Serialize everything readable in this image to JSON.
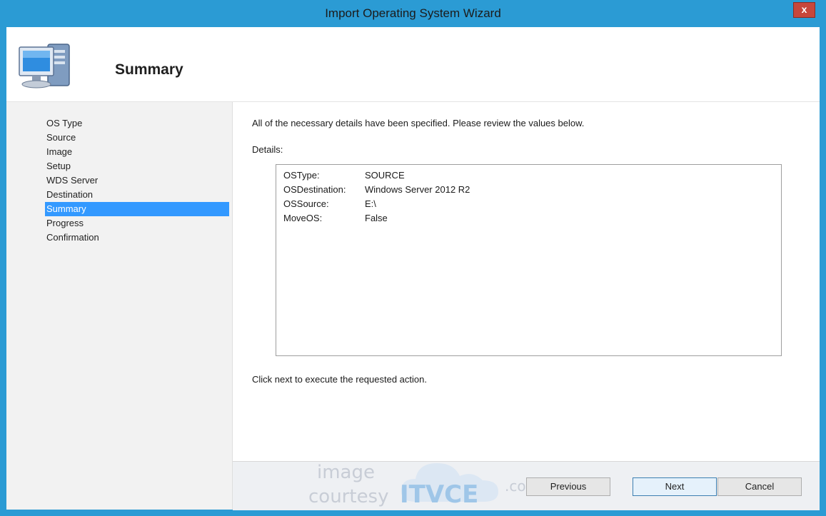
{
  "window": {
    "title": "Import Operating System Wizard",
    "close_label": "x"
  },
  "header": {
    "title": "Summary",
    "icon": "computer-icon"
  },
  "nav": {
    "items": [
      {
        "label": "OS Type",
        "selected": false
      },
      {
        "label": "Source",
        "selected": false
      },
      {
        "label": "Image",
        "selected": false
      },
      {
        "label": "Setup",
        "selected": false
      },
      {
        "label": "WDS Server",
        "selected": false
      },
      {
        "label": "Destination",
        "selected": false
      },
      {
        "label": "Summary",
        "selected": true
      },
      {
        "label": "Progress",
        "selected": false
      },
      {
        "label": "Confirmation",
        "selected": false
      }
    ]
  },
  "content": {
    "intro": "All of the necessary details have been specified.  Please review the values below.",
    "details_label": "Details:",
    "details": [
      {
        "key": "OSType:",
        "value": "SOURCE"
      },
      {
        "key": "OSDestination:",
        "value": "Windows Server 2012 R2"
      },
      {
        "key": "OSSource:",
        "value": "E:\\"
      },
      {
        "key": "MoveOS:",
        "value": "False"
      }
    ],
    "exec_note": "Click next to execute the requested action."
  },
  "footer": {
    "previous_label": "Previous",
    "next_label": "Next",
    "cancel_label": "Cancel"
  },
  "watermark": {
    "line1": "image",
    "line2": "courtesy",
    "brand": "ITVCE",
    "suffix": ".com"
  },
  "colors": {
    "titlebar": "#2b9bd4",
    "selection": "#3399ff",
    "close": "#c7473b"
  }
}
